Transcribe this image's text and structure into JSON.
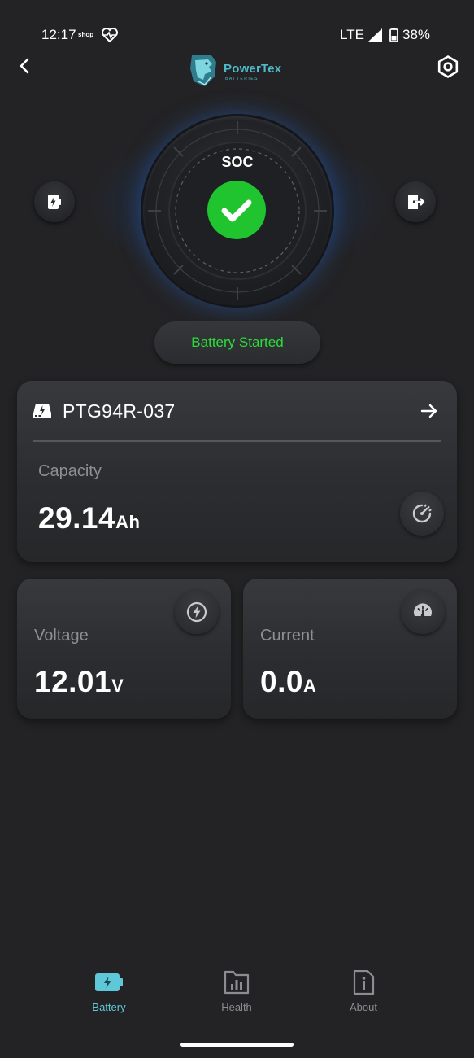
{
  "status_bar": {
    "time": "12:17",
    "shop_label": "shop",
    "network": "LTE",
    "battery_pct": "38%",
    "icons": [
      "heart-monitor-icon",
      "signal-icon",
      "battery-icon"
    ]
  },
  "header": {
    "logo_text": "PowerTex",
    "logo_sub": "BATTERIES",
    "icons": [
      "back-arrow-icon",
      "settings-icon"
    ]
  },
  "hero": {
    "soc_label": "SOC",
    "status_icon": "check-icon",
    "left_button_icon": "battery-charge-icon",
    "right_button_icon": "exit-icon"
  },
  "status_pill": {
    "text": "Battery Started",
    "color": "#2cdc3a"
  },
  "device_card": {
    "name": "PTG94R-037",
    "capacity_label": "Capacity",
    "capacity_value": "29.14",
    "capacity_unit": "Ah",
    "icons": [
      "battery-device-icon",
      "arrow-right-icon",
      "speedometer-icon"
    ]
  },
  "voltage_card": {
    "label": "Voltage",
    "value": "12.01",
    "unit": "V",
    "icon": "lightning-icon"
  },
  "current_card": {
    "label": "Current",
    "value": "0.0",
    "unit": "A",
    "icon": "gauge-icon"
  },
  "bottom_nav": {
    "items": [
      {
        "label": "Battery",
        "icon": "battery-tab-icon",
        "active": true
      },
      {
        "label": "Health",
        "icon": "chart-tab-icon",
        "active": false
      },
      {
        "label": "About",
        "icon": "info-tab-icon",
        "active": false
      }
    ]
  },
  "colors": {
    "background": "#232325",
    "accent_teal": "#5fc8d8",
    "success_green": "#1fc42e",
    "glow_blue": "#286edc"
  }
}
